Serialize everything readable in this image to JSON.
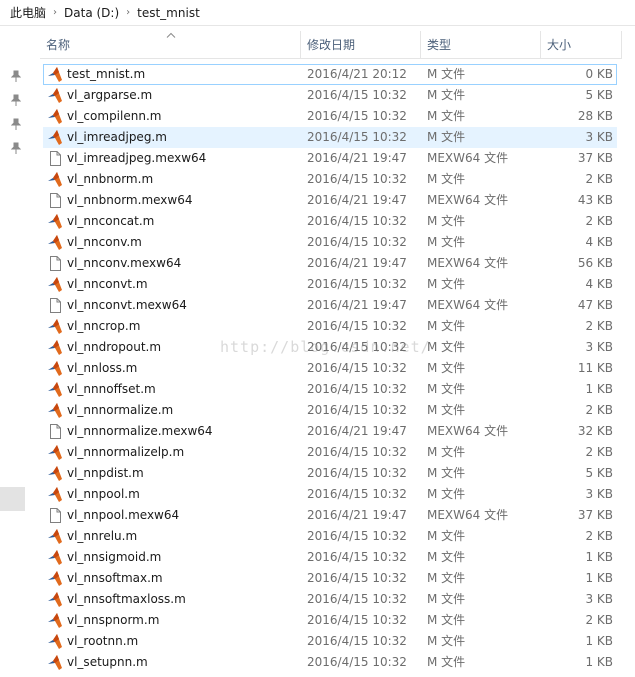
{
  "breadcrumb": {
    "items": [
      "此电脑",
      "Data (D:)",
      "test_mnist"
    ]
  },
  "columns": {
    "name": "名称",
    "date": "修改日期",
    "type": "类型",
    "size": "大小"
  },
  "watermark": "http://blog.csdn.net/",
  "colors": {
    "matlab_orange": "#e16a1d",
    "matlab_blue": "#2b5a97",
    "header_text": "#4c607a",
    "hover": "#e5f3ff",
    "select_border": "#99d1ff"
  },
  "files": [
    {
      "name": "test_mnist.m",
      "date": "2016/4/21 20:12",
      "type": "M 文件",
      "size": "0 KB",
      "icon": "matlab-file-icon",
      "state": "selected"
    },
    {
      "name": "vl_argparse.m",
      "date": "2016/4/15 10:32",
      "type": "M 文件",
      "size": "5 KB",
      "icon": "matlab-file-icon"
    },
    {
      "name": "vl_compilenn.m",
      "date": "2016/4/15 10:32",
      "type": "M 文件",
      "size": "28 KB",
      "icon": "matlab-file-icon"
    },
    {
      "name": "vl_imreadjpeg.m",
      "date": "2016/4/15 10:32",
      "type": "M 文件",
      "size": "3 KB",
      "icon": "matlab-file-icon",
      "state": "hovered"
    },
    {
      "name": "vl_imreadjpeg.mexw64",
      "date": "2016/4/21 19:47",
      "type": "MEXW64 文件",
      "size": "37 KB",
      "icon": "blank-file-icon"
    },
    {
      "name": "vl_nnbnorm.m",
      "date": "2016/4/15 10:32",
      "type": "M 文件",
      "size": "2 KB",
      "icon": "matlab-file-icon"
    },
    {
      "name": "vl_nnbnorm.mexw64",
      "date": "2016/4/21 19:47",
      "type": "MEXW64 文件",
      "size": "43 KB",
      "icon": "blank-file-icon"
    },
    {
      "name": "vl_nnconcat.m",
      "date": "2016/4/15 10:32",
      "type": "M 文件",
      "size": "2 KB",
      "icon": "matlab-file-icon"
    },
    {
      "name": "vl_nnconv.m",
      "date": "2016/4/15 10:32",
      "type": "M 文件",
      "size": "4 KB",
      "icon": "matlab-file-icon"
    },
    {
      "name": "vl_nnconv.mexw64",
      "date": "2016/4/21 19:47",
      "type": "MEXW64 文件",
      "size": "56 KB",
      "icon": "blank-file-icon"
    },
    {
      "name": "vl_nnconvt.m",
      "date": "2016/4/15 10:32",
      "type": "M 文件",
      "size": "4 KB",
      "icon": "matlab-file-icon"
    },
    {
      "name": "vl_nnconvt.mexw64",
      "date": "2016/4/21 19:47",
      "type": "MEXW64 文件",
      "size": "47 KB",
      "icon": "blank-file-icon"
    },
    {
      "name": "vl_nncrop.m",
      "date": "2016/4/15 10:32",
      "type": "M 文件",
      "size": "2 KB",
      "icon": "matlab-file-icon"
    },
    {
      "name": "vl_nndropout.m",
      "date": "2016/4/15 10:32",
      "type": "M 文件",
      "size": "3 KB",
      "icon": "matlab-file-icon"
    },
    {
      "name": "vl_nnloss.m",
      "date": "2016/4/15 10:32",
      "type": "M 文件",
      "size": "11 KB",
      "icon": "matlab-file-icon"
    },
    {
      "name": "vl_nnnoffset.m",
      "date": "2016/4/15 10:32",
      "type": "M 文件",
      "size": "1 KB",
      "icon": "matlab-file-icon"
    },
    {
      "name": "vl_nnnormalize.m",
      "date": "2016/4/15 10:32",
      "type": "M 文件",
      "size": "2 KB",
      "icon": "matlab-file-icon"
    },
    {
      "name": "vl_nnnormalize.mexw64",
      "date": "2016/4/21 19:47",
      "type": "MEXW64 文件",
      "size": "32 KB",
      "icon": "blank-file-icon"
    },
    {
      "name": "vl_nnnormalizelp.m",
      "date": "2016/4/15 10:32",
      "type": "M 文件",
      "size": "2 KB",
      "icon": "matlab-file-icon"
    },
    {
      "name": "vl_nnpdist.m",
      "date": "2016/4/15 10:32",
      "type": "M 文件",
      "size": "5 KB",
      "icon": "matlab-file-icon"
    },
    {
      "name": "vl_nnpool.m",
      "date": "2016/4/15 10:32",
      "type": "M 文件",
      "size": "3 KB",
      "icon": "matlab-file-icon"
    },
    {
      "name": "vl_nnpool.mexw64",
      "date": "2016/4/21 19:47",
      "type": "MEXW64 文件",
      "size": "37 KB",
      "icon": "blank-file-icon"
    },
    {
      "name": "vl_nnrelu.m",
      "date": "2016/4/15 10:32",
      "type": "M 文件",
      "size": "2 KB",
      "icon": "matlab-file-icon"
    },
    {
      "name": "vl_nnsigmoid.m",
      "date": "2016/4/15 10:32",
      "type": "M 文件",
      "size": "1 KB",
      "icon": "matlab-file-icon"
    },
    {
      "name": "vl_nnsoftmax.m",
      "date": "2016/4/15 10:32",
      "type": "M 文件",
      "size": "1 KB",
      "icon": "matlab-file-icon"
    },
    {
      "name": "vl_nnsoftmaxloss.m",
      "date": "2016/4/15 10:32",
      "type": "M 文件",
      "size": "3 KB",
      "icon": "matlab-file-icon"
    },
    {
      "name": "vl_nnspnorm.m",
      "date": "2016/4/15 10:32",
      "type": "M 文件",
      "size": "2 KB",
      "icon": "matlab-file-icon"
    },
    {
      "name": "vl_rootnn.m",
      "date": "2016/4/15 10:32",
      "type": "M 文件",
      "size": "1 KB",
      "icon": "matlab-file-icon"
    },
    {
      "name": "vl_setupnn.m",
      "date": "2016/4/15 10:32",
      "type": "M 文件",
      "size": "1 KB",
      "icon": "matlab-file-icon"
    }
  ]
}
